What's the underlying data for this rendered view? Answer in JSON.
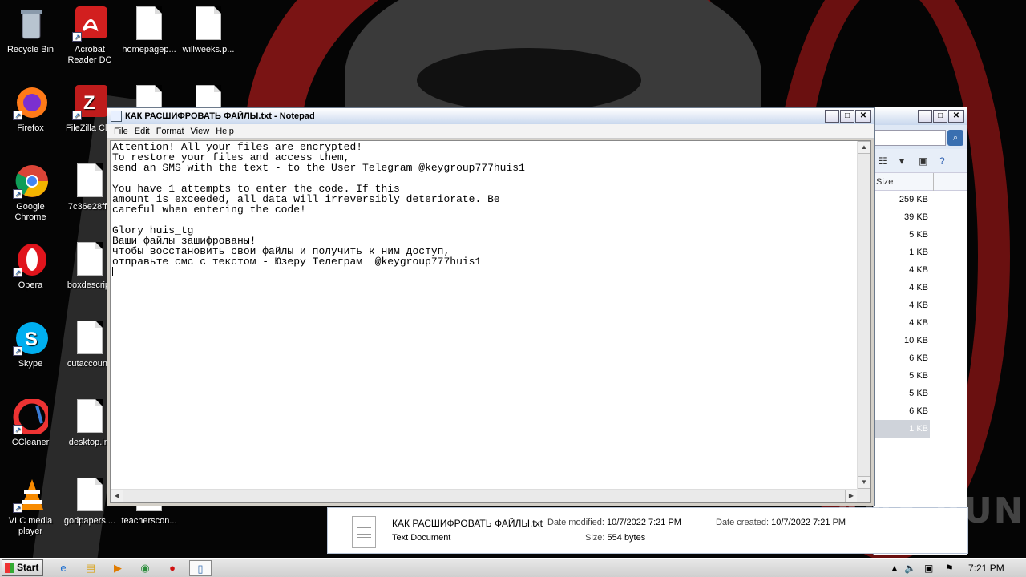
{
  "desktop": {
    "icons": [
      {
        "label": "Recycle Bin"
      },
      {
        "label": "Acrobat Reader DC"
      },
      {
        "label": "homepagep..."
      },
      {
        "label": "willweeks.p..."
      },
      {
        "label": "Firefox"
      },
      {
        "label": "FileZilla Clie"
      },
      {
        "label": "Google Chrome"
      },
      {
        "label": "7c36e28ff8"
      },
      {
        "label": "Opera"
      },
      {
        "label": "boxdescript"
      },
      {
        "label": "Skype"
      },
      {
        "label": "cutaccount."
      },
      {
        "label": "CCleaner"
      },
      {
        "label": "desktop.ini"
      },
      {
        "label": "VLC media player"
      },
      {
        "label": "godpapers...."
      },
      {
        "label": "teacherscon..."
      }
    ]
  },
  "notepad": {
    "title": "КАК РАСШИФРОВАТЬ ФАЙЛЫ.txt - Notepad",
    "menu": [
      "File",
      "Edit",
      "Format",
      "View",
      "Help"
    ],
    "lines": [
      "Attention! All your files are encrypted!",
      "To restore your files and access them,",
      "send an SMS with the text - to the User Telegram @keygroup777huis1",
      "",
      "You have 1 attempts to enter the code. If this",
      "amount is exceeded, all data will irreversibly deteriorate. Be",
      "careful when entering the code!",
      "",
      "Glory huis_tg",
      "Ваши файлы зашифрованы!",
      "чтобы восстановить свои файлы и получить к ним доступ,",
      "отправьте смс с текстом - Юзеру Телеграм  @keygroup777huis1"
    ]
  },
  "explorer": {
    "column_header": "Size",
    "sizes": [
      "259 KB",
      "39 KB",
      "5 KB",
      "1 KB",
      "4 KB",
      "4 KB",
      "4 KB",
      "4 KB",
      "10 KB",
      "6 KB",
      "5 KB",
      "5 KB",
      "6 KB",
      "1 KB"
    ]
  },
  "details": {
    "filename": "КАК РАСШИФРОВАТЬ ФАЙЛЫ.txt",
    "type": "Text Document",
    "modified_label": "Date modified:",
    "modified": "10/7/2022 7:21 PM",
    "size_label": "Size:",
    "size": "554 bytes",
    "created_label": "Date created:",
    "created": "10/7/2022 7:21 PM"
  },
  "watermark": "ANY RUN",
  "taskbar": {
    "start_label": "Start",
    "clock": "7:21 PM"
  }
}
